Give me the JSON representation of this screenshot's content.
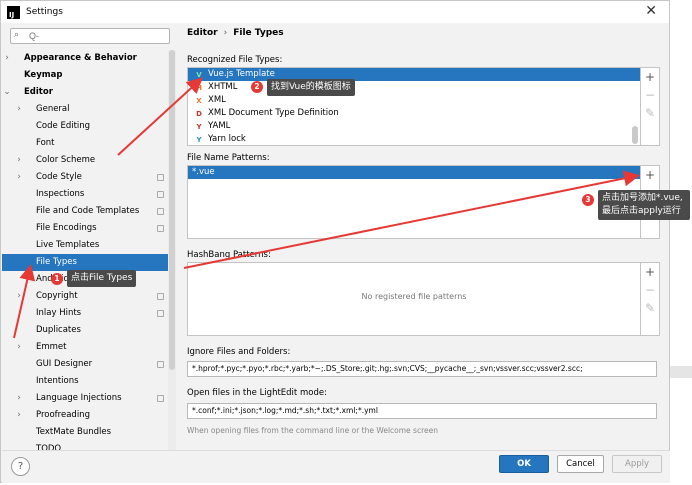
{
  "window": {
    "title": "Settings",
    "app_icon": "IJ"
  },
  "search": {
    "placeholder": "Q-"
  },
  "sidebar": {
    "items": [
      {
        "label": "Appearance & Behavior",
        "arrow": "›",
        "level": 0,
        "bold": true
      },
      {
        "label": "Keymap",
        "arrow": "",
        "level": 0,
        "bold": true
      },
      {
        "label": "Editor",
        "arrow": "⌄",
        "level": 0,
        "bold": true
      },
      {
        "label": "General",
        "arrow": "›",
        "level": 1
      },
      {
        "label": "Code Editing",
        "arrow": "",
        "level": 1
      },
      {
        "label": "Font",
        "arrow": "",
        "level": 1
      },
      {
        "label": "Color Scheme",
        "arrow": "›",
        "level": 1
      },
      {
        "label": "Code Style",
        "arrow": "›",
        "level": 1,
        "proj": true
      },
      {
        "label": "Inspections",
        "arrow": "",
        "level": 1,
        "proj": true
      },
      {
        "label": "File and Code Templates",
        "arrow": "",
        "level": 1,
        "proj": true
      },
      {
        "label": "File Encodings",
        "arrow": "",
        "level": 1,
        "proj": true
      },
      {
        "label": "Live Templates",
        "arrow": "",
        "level": 1
      },
      {
        "label": "File Types",
        "arrow": "",
        "level": 1,
        "selected": true
      },
      {
        "label": "Android Layout Editor",
        "arrow": "",
        "level": 1
      },
      {
        "label": "Copyright",
        "arrow": "›",
        "level": 1,
        "proj": true
      },
      {
        "label": "Inlay Hints",
        "arrow": "",
        "level": 1,
        "proj": true
      },
      {
        "label": "Duplicates",
        "arrow": "",
        "level": 1
      },
      {
        "label": "Emmet",
        "arrow": "›",
        "level": 1
      },
      {
        "label": "GUI Designer",
        "arrow": "",
        "level": 1,
        "proj": true
      },
      {
        "label": "Intentions",
        "arrow": "",
        "level": 1
      },
      {
        "label": "Language Injections",
        "arrow": "›",
        "level": 1,
        "proj": true
      },
      {
        "label": "Proofreading",
        "arrow": "›",
        "level": 1
      },
      {
        "label": "TextMate Bundles",
        "arrow": "",
        "level": 1
      },
      {
        "label": "TODO",
        "arrow": "",
        "level": 1
      }
    ]
  },
  "breadcrumb": {
    "parent": "Editor",
    "sep": "›",
    "current": "File Types"
  },
  "recognized": {
    "label": "Recognized File Types:",
    "items": [
      {
        "label": "Vue.js Template",
        "icon": "V",
        "color": "#41b883",
        "selected": true
      },
      {
        "label": "XHTML",
        "icon": "H",
        "color": "#e8762d"
      },
      {
        "label": "XML",
        "icon": "X",
        "color": "#e8762d"
      },
      {
        "label": "XML Document Type Definition",
        "icon": "D",
        "color": "#c0392b"
      },
      {
        "label": "YAML",
        "icon": "Y",
        "color": "#c0392b"
      },
      {
        "label": "Yarn lock",
        "icon": "Y",
        "color": "#2c8ebb"
      }
    ]
  },
  "patterns": {
    "label": "File Name Patterns:",
    "items": [
      {
        "label": "*.vue",
        "selected": true
      }
    ]
  },
  "hashbang": {
    "label": "HashBang Patterns:",
    "empty": "No registered file patterns"
  },
  "ignore": {
    "label": "Ignore Files and Folders:",
    "value": "*.hprof;*.pyc;*.pyo;*.rbc;*.yarb;*~;.DS_Store;.git;.hg;.svn;CVS;__pycache__;_svn;vssver.scc;vssver2.scc;"
  },
  "lightedit": {
    "label": "Open files in the LightEdit mode:",
    "value": "*.conf;*.ini;*.json;*.log;*.md;*.sh;*.txt;*.xml;*.yml",
    "hint": "When opening files from the command line or the Welcome screen"
  },
  "tools": {
    "add": "+",
    "remove": "−",
    "edit": "✎"
  },
  "footer": {
    "help": "?",
    "ok": "OK",
    "cancel": "Cancel",
    "apply": "Apply"
  },
  "annotations": [
    {
      "num": "1",
      "text": "点击File Types"
    },
    {
      "num": "2",
      "text": "找到Vue的模板图标"
    },
    {
      "num": "3",
      "text": "点击加号添加*.vue,最后点击apply运行"
    }
  ],
  "colors": {
    "accent": "#2675bf",
    "badge": "#e53935",
    "arrow": "#e53935",
    "tip_bg": "#4a4a4a"
  }
}
